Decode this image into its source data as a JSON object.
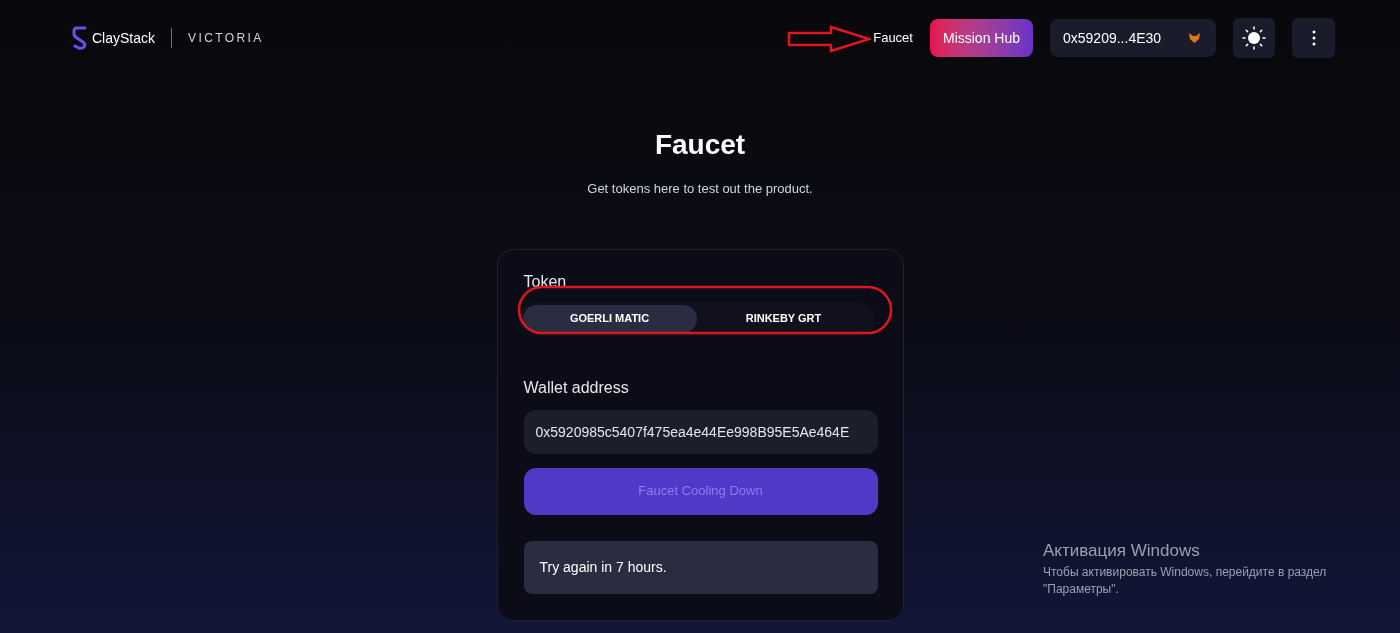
{
  "header": {
    "brand": "ClayStack",
    "network": "VICTORIA",
    "nav_link": "Faucet",
    "mission_button": "Mission Hub",
    "wallet": "0x59209...4E30"
  },
  "page": {
    "title": "Faucet",
    "subtitle": "Get tokens here to test out the product."
  },
  "form": {
    "token_label": "Token",
    "tokens": [
      {
        "label": "GOERLI MATIC",
        "selected": true
      },
      {
        "label": "RINKEBY GRT",
        "selected": false
      }
    ],
    "wallet_label": "Wallet address",
    "wallet_value": "0x5920985c5407f475ea4e44Ee998B95E5Ae464E",
    "submit": {
      "label": "Faucet Cooling Down",
      "disabled": true
    },
    "message": "Try again in 7 hours."
  },
  "annotations": {
    "arrow_to_faucet_link": true,
    "circle_around_tokens": true
  },
  "os_notice": {
    "title": "Активация Windows",
    "text": "Чтобы активировать Windows, перейдите в раздел \"Параметры\"."
  }
}
